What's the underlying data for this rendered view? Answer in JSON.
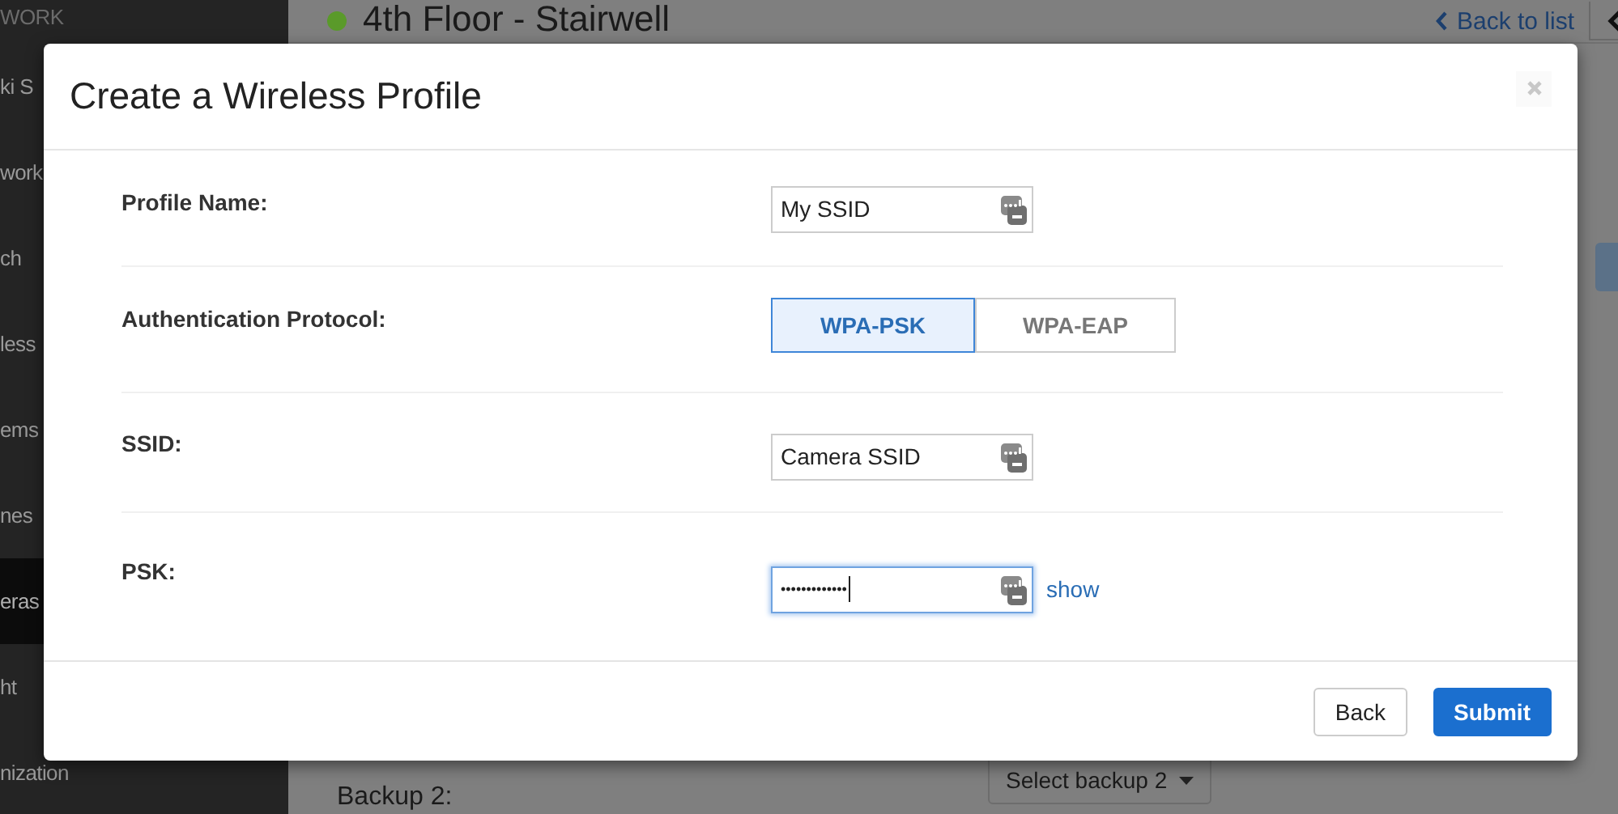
{
  "sidebar": {
    "items": [
      {
        "label": "WORK",
        "kind": "heading",
        "selected": false
      },
      {
        "label": "ki S",
        "kind": "item",
        "selected": false
      },
      {
        "label": "work",
        "kind": "item",
        "selected": false
      },
      {
        "label": "ch",
        "kind": "item",
        "selected": false
      },
      {
        "label": "less",
        "kind": "item",
        "selected": false
      },
      {
        "label": "ems",
        "kind": "item",
        "selected": false
      },
      {
        "label": "nes",
        "kind": "item",
        "selected": false
      },
      {
        "label": "eras",
        "kind": "item",
        "selected": true
      },
      {
        "label": "ht",
        "kind": "item",
        "selected": false
      },
      {
        "label": "nization",
        "kind": "item",
        "selected": false
      }
    ]
  },
  "page": {
    "title": "4th Floor - Stairwell",
    "back_link": "Back to list",
    "backup_label": "Backup 2:",
    "backup_select": "Select backup 2"
  },
  "dialog": {
    "title": "Create a Wireless Profile",
    "fields": [
      {
        "label": "Profile Name:",
        "kind": "text",
        "value": "My SSID",
        "focused": false
      },
      {
        "label": "Authentication Protocol:",
        "kind": "toggle",
        "options": [
          {
            "label": "WPA-PSK",
            "selected": true
          },
          {
            "label": "WPA-EAP",
            "selected": false
          }
        ]
      },
      {
        "label": "SSID:",
        "kind": "text",
        "value": "Camera SSID",
        "focused": false
      },
      {
        "label": "PSK:",
        "kind": "password",
        "value": "•••••••••••••",
        "focused": true,
        "link": "show"
      }
    ],
    "buttons": [
      {
        "label": "Back",
        "kind": "default"
      },
      {
        "label": "Submit",
        "kind": "primary"
      }
    ]
  }
}
